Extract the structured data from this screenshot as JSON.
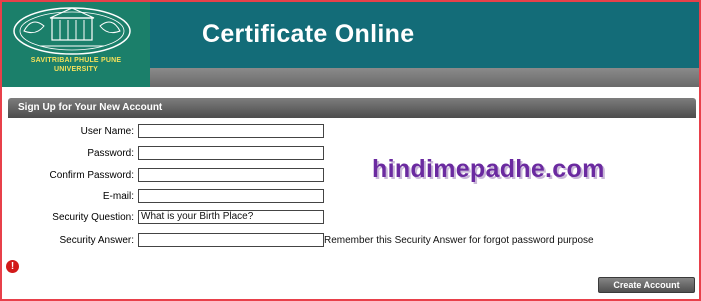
{
  "header": {
    "title": "Certificate Online",
    "university": "SAVITRIBAI PHULE PUNE UNIVERSITY",
    "university_line1": "SAVITRIBAI PHULE PUNE",
    "university_line2": "UNIVERSITY",
    "colors": {
      "header_bg": "#136c78",
      "logo_bg": "#1b7f6a",
      "university_text": "#f4e15a"
    }
  },
  "form": {
    "section_title": "Sign Up for Your New Account",
    "fields": [
      {
        "label": "User Name:",
        "value": ""
      },
      {
        "label": "Password:",
        "value": ""
      },
      {
        "label": "Confirm Password:",
        "value": ""
      },
      {
        "label": "E-mail:",
        "value": ""
      },
      {
        "label": "Security Question:",
        "value": "What is your Birth Place?"
      },
      {
        "label": "Security Answer:",
        "value": ""
      }
    ],
    "security_answer_hint": "Remember this Security Answer for forgot password purpose",
    "submit_label": "Create Account"
  },
  "watermark": {
    "text": "hindimepadhe.com",
    "color": "#6b2aa0"
  },
  "frame_border_color": "#e8404a"
}
